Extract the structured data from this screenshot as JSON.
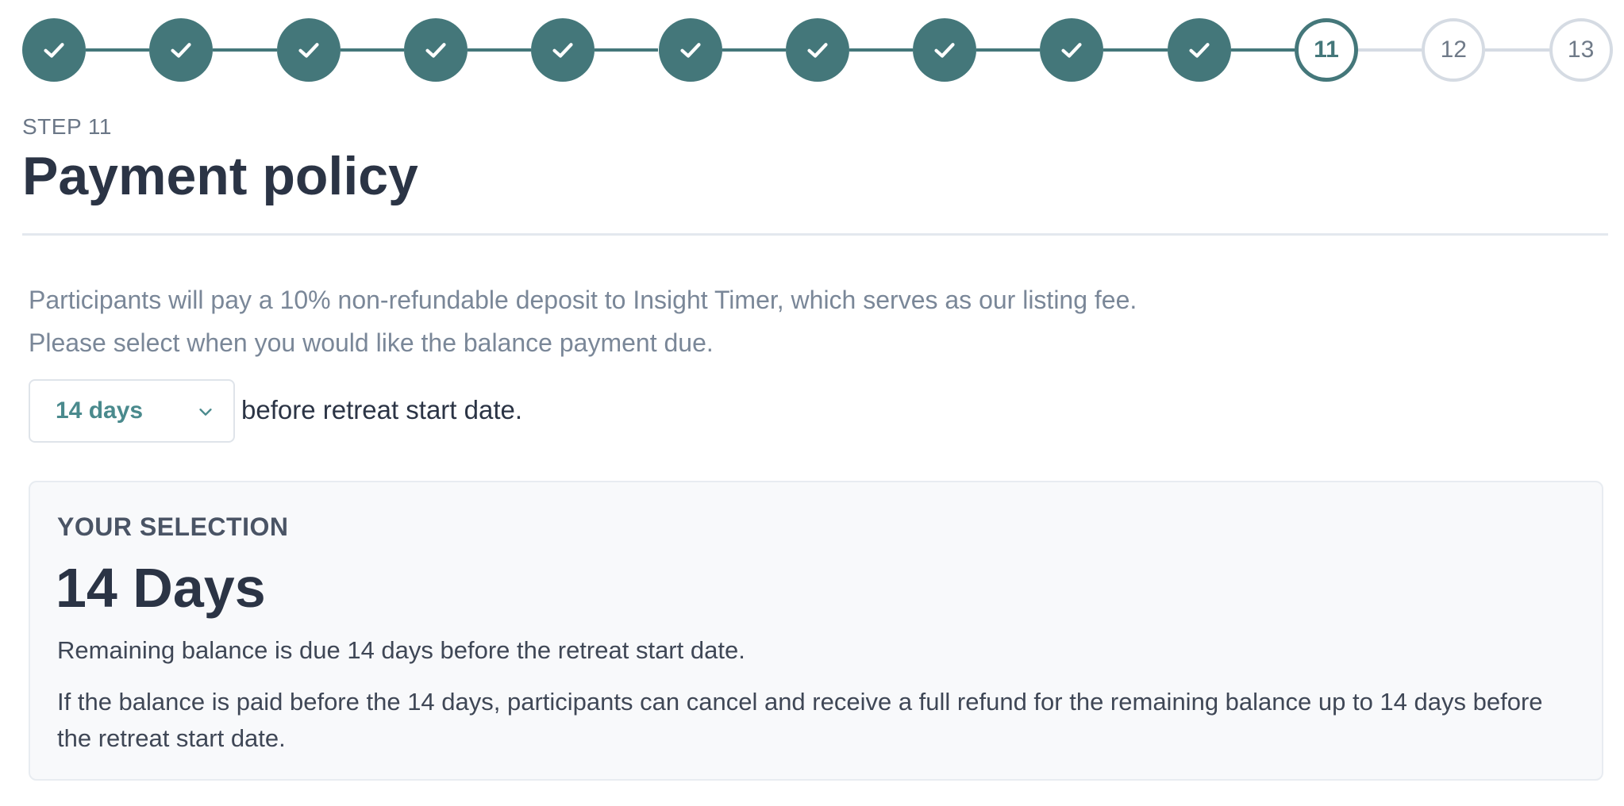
{
  "stepper": {
    "total_steps": 13,
    "current_step": 11,
    "colors": {
      "complete": "#44777a",
      "upcoming": "#d5dbe3"
    },
    "steps": [
      {
        "label": "1",
        "state": "complete",
        "icon": "check-icon"
      },
      {
        "label": "2",
        "state": "complete",
        "icon": "check-icon"
      },
      {
        "label": "3",
        "state": "complete",
        "icon": "check-icon"
      },
      {
        "label": "4",
        "state": "complete",
        "icon": "check-icon"
      },
      {
        "label": "5",
        "state": "complete",
        "icon": "check-icon"
      },
      {
        "label": "6",
        "state": "complete",
        "icon": "check-icon"
      },
      {
        "label": "7",
        "state": "complete",
        "icon": "check-icon"
      },
      {
        "label": "8",
        "state": "complete",
        "icon": "check-icon"
      },
      {
        "label": "9",
        "state": "complete",
        "icon": "check-icon"
      },
      {
        "label": "10",
        "state": "complete",
        "icon": "check-icon"
      },
      {
        "label": "11",
        "state": "current",
        "icon": ""
      },
      {
        "label": "12",
        "state": "upcoming",
        "icon": ""
      },
      {
        "label": "13",
        "state": "upcoming",
        "icon": ""
      }
    ]
  },
  "header": {
    "step_label": "STEP 11",
    "title": "Payment policy"
  },
  "description": {
    "line1": "Participants will pay a 10% non-refundable deposit to Insight Timer, which serves as our listing fee.",
    "line2": "Please select when you would like the balance payment due."
  },
  "balance_due": {
    "selected_value": "14 days",
    "dropdown_icon": "chevron-down-icon",
    "suffix": "before retreat start date."
  },
  "selection": {
    "label": "YOUR SELECTION",
    "value": "14 Days",
    "line1": "Remaining balance is due 14 days before the retreat start date.",
    "line2": "If the balance is paid before the 14 days, participants can cancel and receive a full refund for the remaining balance up to 14 days before the retreat start date."
  }
}
